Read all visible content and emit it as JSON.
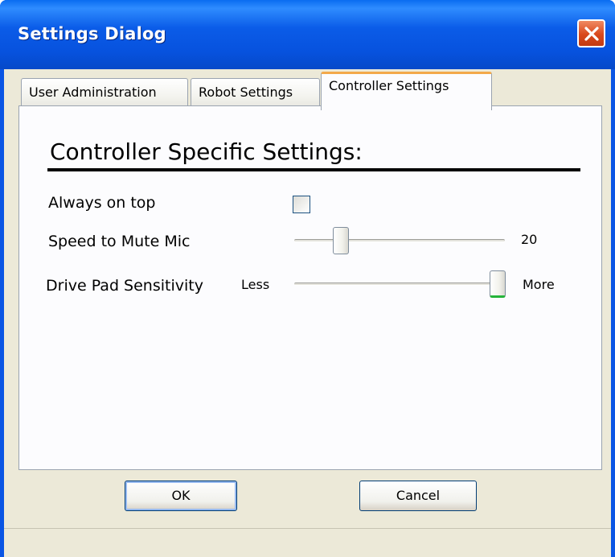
{
  "window": {
    "title": "Settings Dialog",
    "accent_color": "#0a55e4",
    "close_icon": "close-icon"
  },
  "tabs": [
    {
      "label": "User Administration",
      "active": false
    },
    {
      "label": "Robot Settings",
      "active": false
    },
    {
      "label": "Controller Settings",
      "active": true
    }
  ],
  "panel": {
    "heading": "Controller Specific Settings:",
    "always_on_top": {
      "label": "Always on top",
      "checked": false
    },
    "speed_to_mute_mic": {
      "label": "Speed to Mute Mic",
      "value": "20",
      "fraction": 0.2
    },
    "drive_pad_sensitivity": {
      "label": "Drive Pad Sensitivity",
      "min_label": "Less",
      "max_label": "More",
      "fraction": 1.0
    }
  },
  "buttons": {
    "ok": "OK",
    "cancel": "Cancel"
  }
}
